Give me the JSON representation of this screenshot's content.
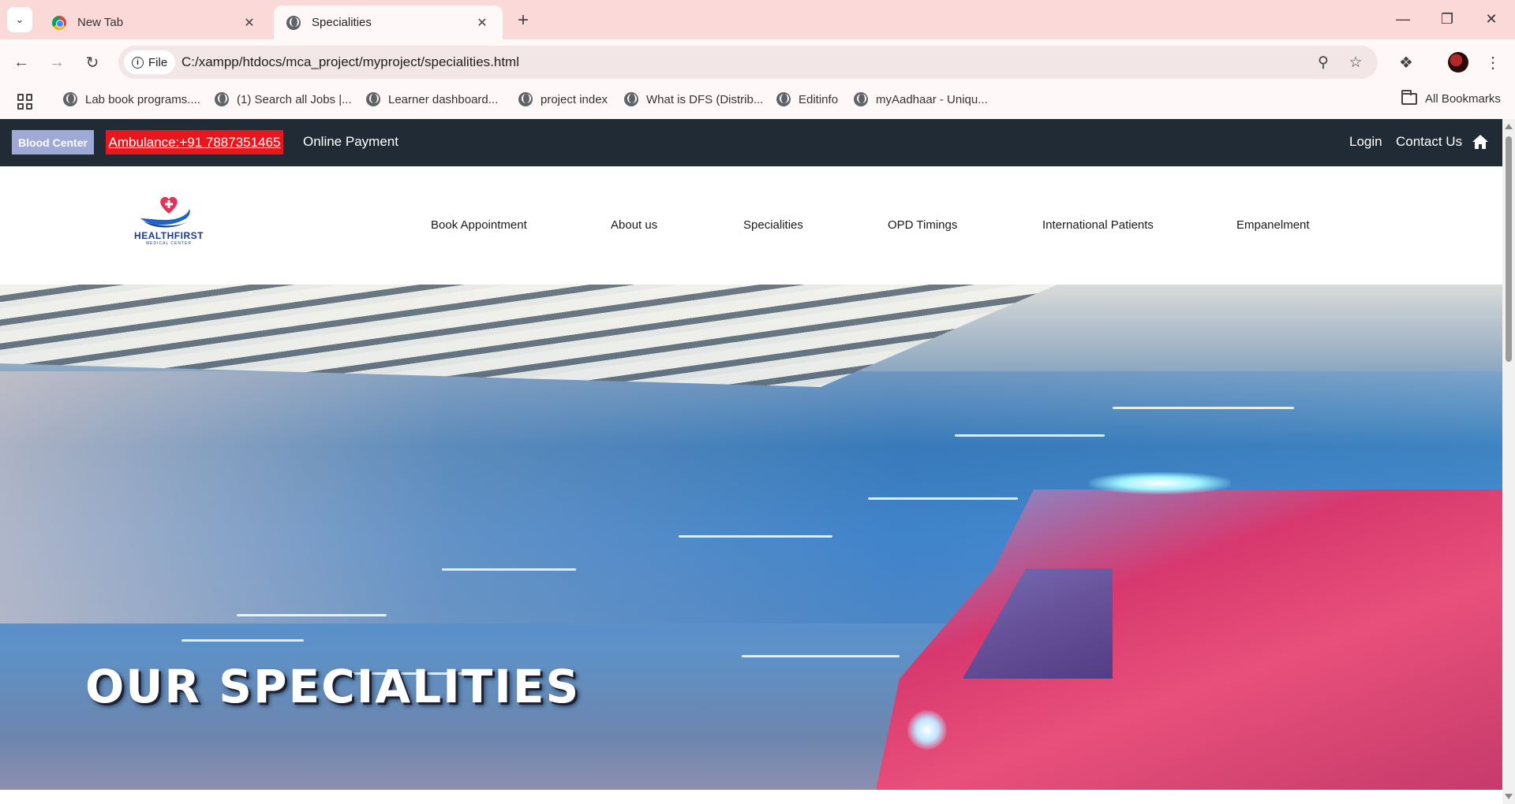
{
  "browser": {
    "tabs": [
      {
        "title": "New Tab",
        "close": "✕"
      },
      {
        "title": "Specialities",
        "close": "✕"
      }
    ],
    "new_tab": "+",
    "chip_label": "File",
    "url": "C:/xampp/htdocs/mca_project/myproject/specialities.html",
    "bookmarks": [
      "Lab book programs....",
      "(1) Search all Jobs |...",
      "Learner dashboard...",
      "project index",
      "What is DFS (Distrib...",
      "Editinfo",
      "myAadhaar - Uniqu..."
    ],
    "all_bookmarks": "All Bookmarks"
  },
  "site": {
    "topbar": {
      "blood_center": "Blood Center",
      "ambulance": "Ambulance:+91 7887351465",
      "online_payment": "Online Payment",
      "login": "Login",
      "contact_us": "Contact Us"
    },
    "logo": {
      "name": "HEALTHFIRST",
      "subtitle": "MEDICAL CENTER"
    },
    "nav": [
      "Book Appointment",
      "About us",
      "Specialities",
      "OPD Timings",
      "International Patients",
      "Empanelment"
    ],
    "hero": {
      "title": "OUR SPECIALITIES"
    },
    "colors": {
      "topbar_bg": "#212b35",
      "blood_center_bg": "#9fa9d6",
      "ambulance_bg": "#e8161d",
      "logo_blue": "#1b3c8c",
      "logo_heart": "#e0355b"
    }
  }
}
